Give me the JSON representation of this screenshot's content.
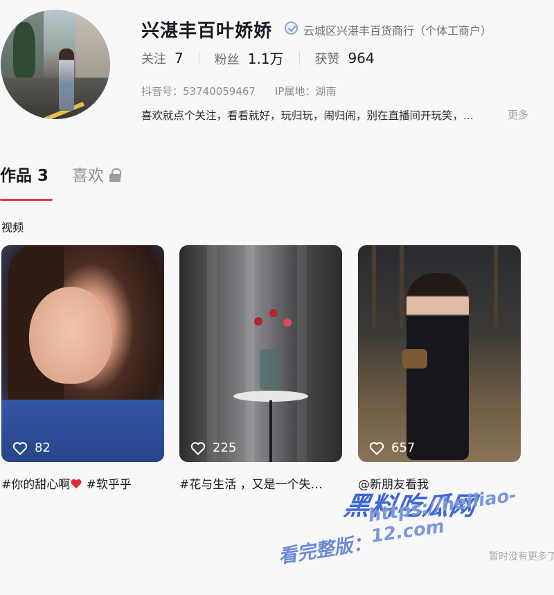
{
  "profile": {
    "nickname": "兴湛丰百叶娇娇",
    "verification": "云城区兴湛丰百货商行（个体工商户）",
    "stats": [
      {
        "label": "关注",
        "value": "7"
      },
      {
        "label": "粉丝",
        "value": "1.1万"
      },
      {
        "label": "获赞",
        "value": "964"
      }
    ],
    "douyin_id": "抖音号：53740059467",
    "ip_location": "IP属地：湖南",
    "bio": "喜欢就点个关注，看看就好，玩归玩，闹归闹，别在直播间开玩笑，...",
    "more_label": "更多"
  },
  "tabs": [
    {
      "label": "作品 3",
      "active": true
    },
    {
      "label": "喜欢",
      "active": false,
      "locked": true
    }
  ],
  "section_label": "视频",
  "videos": [
    {
      "likes": "82",
      "caption_prefix": "#你的甜心啊",
      "caption_suffix": " #软乎乎"
    },
    {
      "likes": "225",
      "caption": "#花与生活 ，又是一个失…"
    },
    {
      "likes": "657",
      "caption": "@新朋友看我"
    }
  ],
  "footer": {
    "no_more": "暂时没有更多了"
  },
  "watermark": {
    "logo": "黑料吃瓜网",
    "url": "https://heiliao-12.com",
    "prefix": "看完整版："
  },
  "colors": {
    "accent": "#e0334e",
    "text_primary": "#161823",
    "text_secondary": "#8a8b93",
    "watermark": "#3f66d6"
  }
}
